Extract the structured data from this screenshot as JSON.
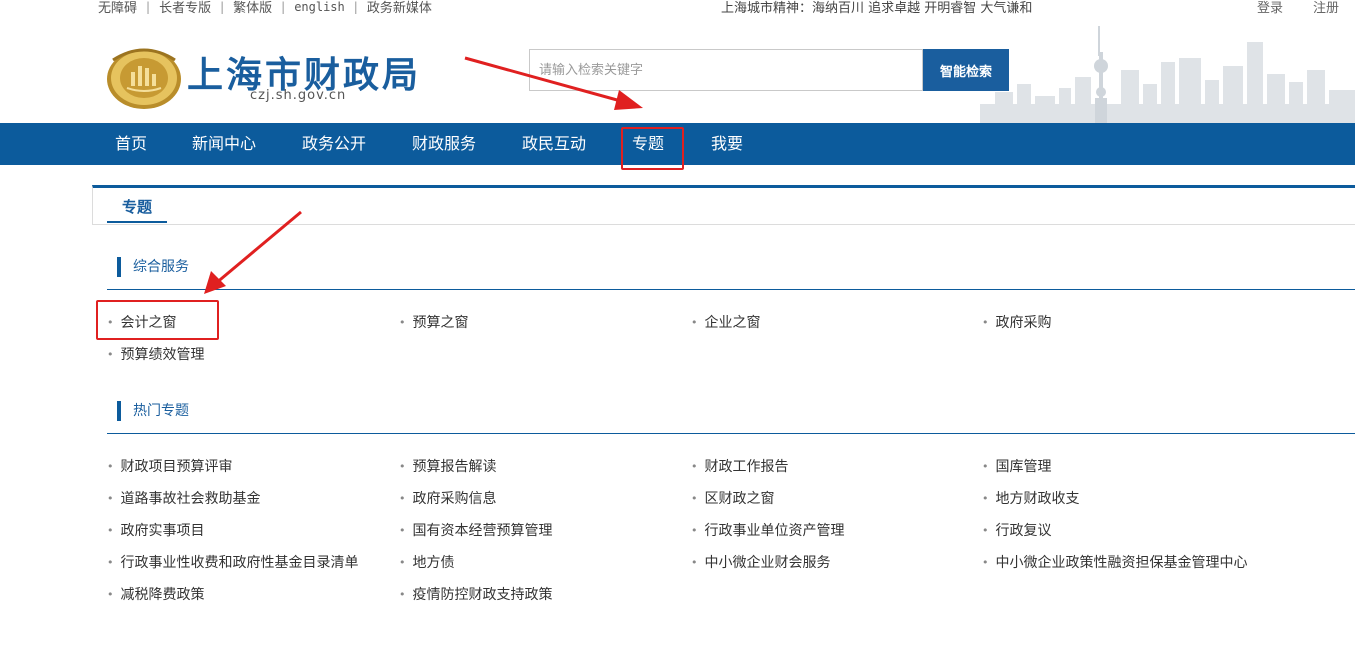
{
  "topbar": {
    "links": [
      "无障碍",
      "长者专版",
      "繁体版",
      "english",
      "政务新媒体"
    ],
    "slogan": "上海城市精神：海纳百川 追求卓越 开明睿智 大气谦和",
    "login": "登录",
    "register": "注册"
  },
  "header": {
    "title": "上海市财政局",
    "domain": "czj.sh.gov.cn",
    "search_placeholder": "请输入检索关键字",
    "search_button": "智能检索"
  },
  "nav": {
    "items": [
      "首页",
      "新闻中心",
      "政务公开",
      "财政服务",
      "政民互动",
      "专题",
      "我要"
    ]
  },
  "section": {
    "tab": "专题"
  },
  "groups": {
    "general": {
      "title": "综合服务",
      "items": [
        "会计之窗",
        "预算之窗",
        "企业之窗",
        "政府采购",
        "预算绩效管理"
      ]
    },
    "hot": {
      "title": "热门专题",
      "items": [
        "财政项目预算评审",
        "预算报告解读",
        "财政工作报告",
        "国库管理",
        "道路事故社会救助基金",
        "政府采购信息",
        "区财政之窗",
        "地方财政收支",
        "政府实事项目",
        "国有资本经营预算管理",
        "行政事业单位资产管理",
        "行政复议",
        "行政事业性收费和政府性基金目录清单",
        "地方债",
        "中小微企业财会服务",
        "中小微企业政策性融资担保基金管理中心",
        "减税降费政策",
        "疫情防控财政支持政策"
      ]
    }
  },
  "colors": {
    "brand_blue": "#0c5b9c",
    "annotation_red": "#e02020"
  }
}
